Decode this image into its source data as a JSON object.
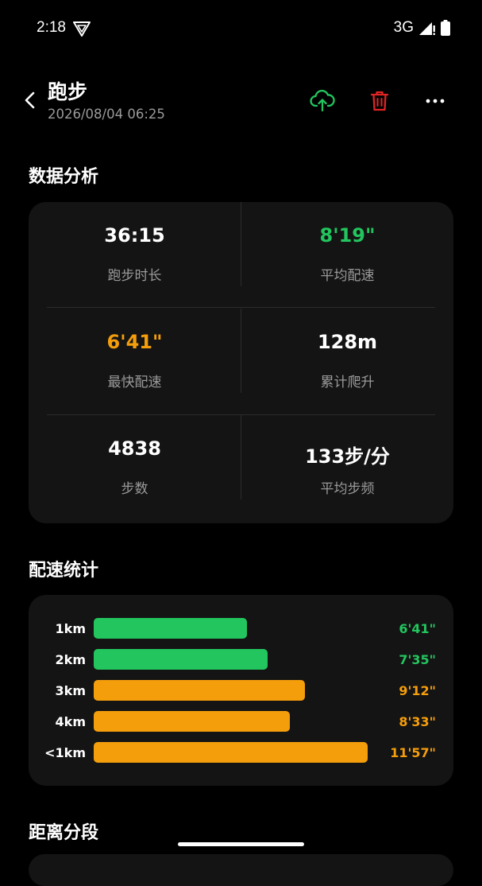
{
  "status_bar": {
    "time": "2:18",
    "network": "3G"
  },
  "header": {
    "title": "跑步",
    "subtitle": "2026/08/04 06:25"
  },
  "sections": {
    "analysis_title": "数据分析",
    "pace_title": "配速统计",
    "distance_title": "距离分段"
  },
  "stats": [
    {
      "value": "36:15",
      "label": "跑步时长"
    },
    {
      "value": "8'19\"",
      "label": "平均配速"
    },
    {
      "value": "6'41\"",
      "label": "最快配速"
    },
    {
      "value": "128m",
      "label": "累计爬升"
    },
    {
      "value": "4838",
      "label": "步数"
    },
    {
      "value": "133步/分",
      "label": "平均步频"
    }
  ],
  "pace": [
    {
      "km": "1km",
      "value": "6'41\"",
      "seconds": 401
    },
    {
      "km": "2km",
      "value": "7'35\"",
      "seconds": 455
    },
    {
      "km": "3km",
      "value": "9'12\"",
      "seconds": 552
    },
    {
      "km": "4km",
      "value": "8'33\"",
      "seconds": 513
    },
    {
      "km": "<1km",
      "value": "11'57\"",
      "seconds": 717
    }
  ],
  "colors": {
    "green": "#22c55e",
    "orange": "#f59e0b",
    "white": "#ffffff",
    "delete_red": "#e02424"
  }
}
